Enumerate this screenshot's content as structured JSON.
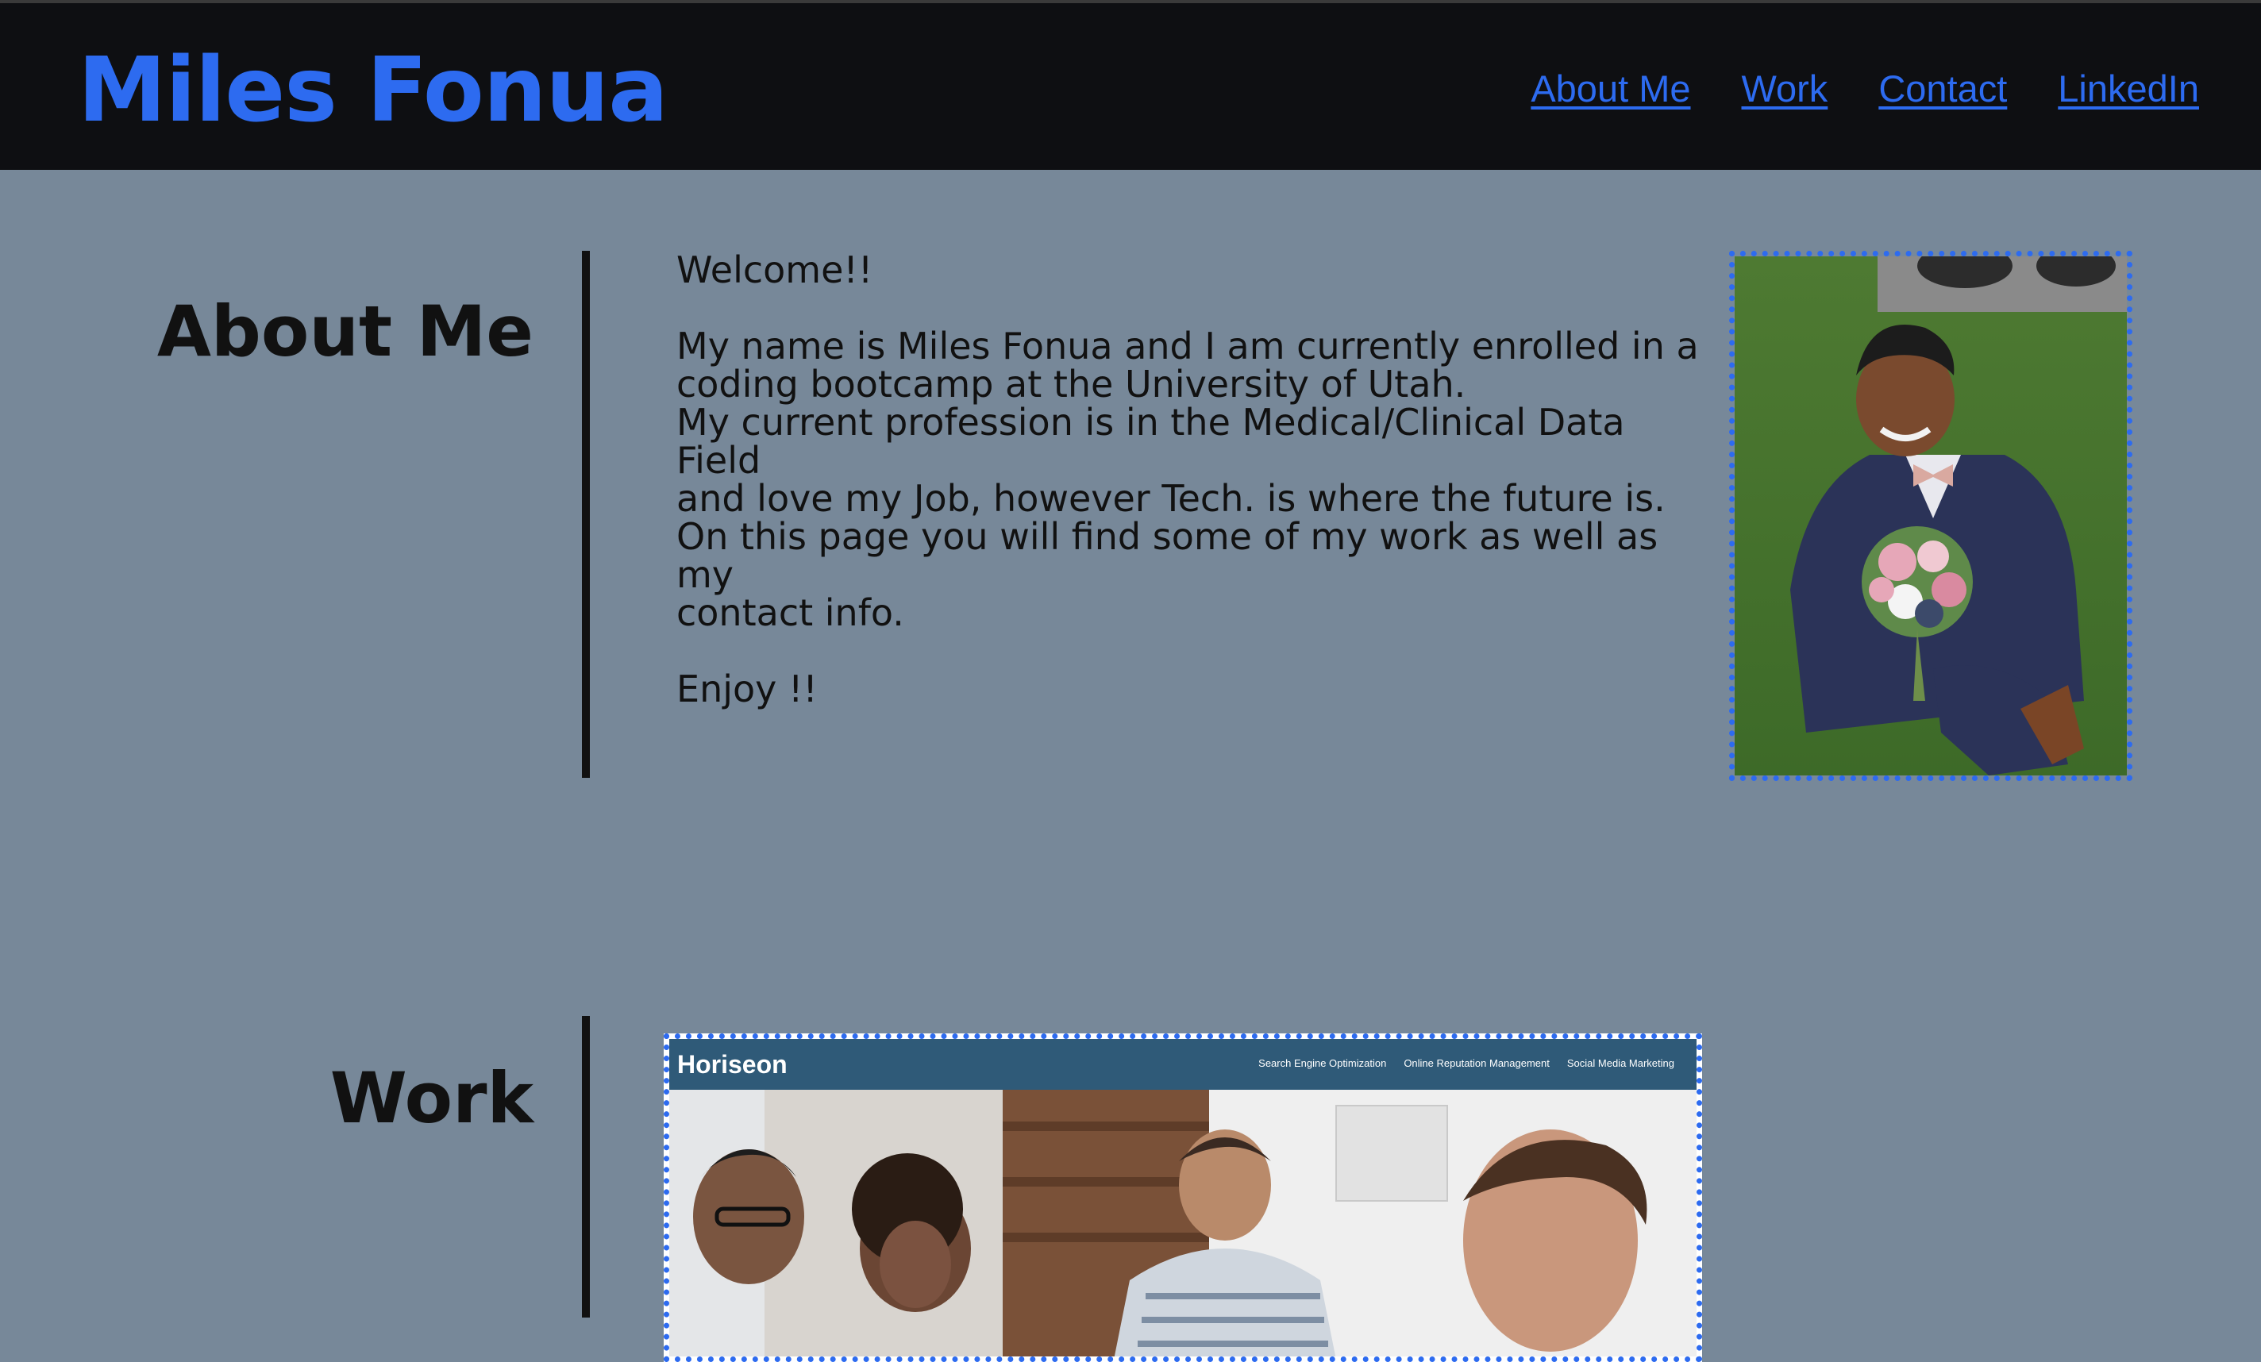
{
  "header": {
    "title": "Miles Fonua",
    "title_color": "#2d6bf0",
    "background": "#0e0f12",
    "nav": [
      {
        "label": "About Me"
      },
      {
        "label": "Work"
      },
      {
        "label": "Contact"
      },
      {
        "label": "LinkedIn"
      }
    ]
  },
  "page": {
    "background": "#778899",
    "accent": "#2d6bf0"
  },
  "about": {
    "heading": "About Me",
    "welcome": "Welcome!!",
    "lines": [
      "My name is Miles Fonua and I am currently enrolled in a",
      "coding bootcamp at the University of Utah.",
      "My current profession is in the Medical/Clinical Data Field",
      "and love my Job, however Tech. is where the future is.",
      "On this page you will find some of my work as well as my",
      "contact info."
    ],
    "closing": "Enjoy !!",
    "photo_icon": "portrait-photo"
  },
  "work": {
    "heading": "Work",
    "project": {
      "brand": "Horiseon",
      "links": [
        "Search Engine Optimization",
        "Online Reputation Management",
        "Social Media Marketing"
      ]
    }
  }
}
